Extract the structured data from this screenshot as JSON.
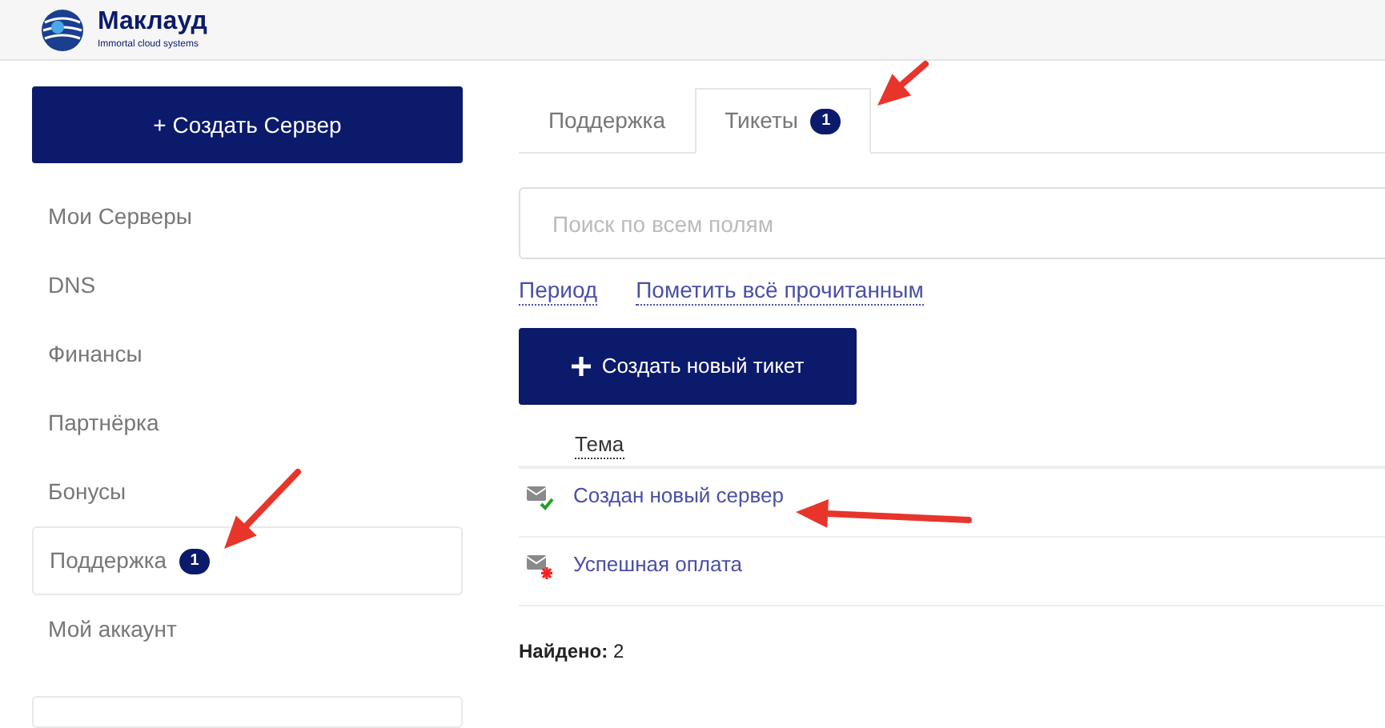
{
  "brand": {
    "name": "Маклауд",
    "tagline": "Immortal cloud systems"
  },
  "sidebar": {
    "create_button": "+ Создать Сервер",
    "items": [
      {
        "label": "Мои Серверы",
        "selected": false
      },
      {
        "label": "DNS",
        "selected": false
      },
      {
        "label": "Финансы",
        "selected": false
      },
      {
        "label": "Партнёрка",
        "selected": false
      },
      {
        "label": "Бонусы",
        "selected": false
      },
      {
        "label": "Поддержка",
        "selected": true,
        "badge": "1"
      },
      {
        "label": "Мой аккаунт",
        "selected": false
      }
    ]
  },
  "tabs": [
    {
      "label": "Поддержка",
      "selected": false
    },
    {
      "label": "Тикеты",
      "selected": true,
      "badge": "1"
    }
  ],
  "search": {
    "placeholder": "Поиск по всем полям"
  },
  "filters": [
    "Период",
    "Пометить всё прочитанным"
  ],
  "new_ticket_button": "Создать новый тикет",
  "table": {
    "columns": [
      "Тема"
    ],
    "rows": [
      {
        "subject": "Создан новый сервер",
        "kind": "answered"
      },
      {
        "subject": "Успешная оплата",
        "kind": "new"
      }
    ]
  },
  "found": {
    "label": "Найдено:",
    "count": "2"
  }
}
